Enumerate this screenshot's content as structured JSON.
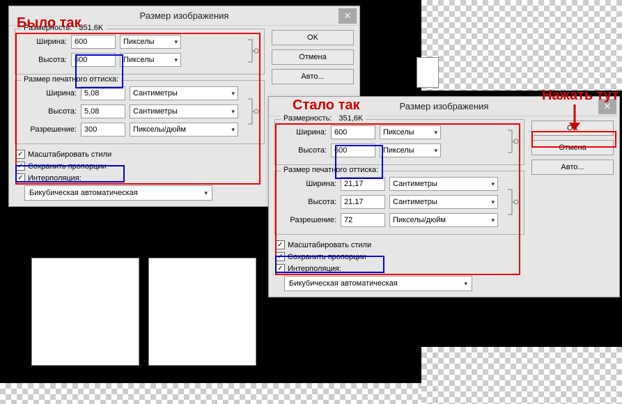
{
  "annotations": {
    "before": "Было так",
    "after": "Стало так",
    "press_here": "Нажать тут"
  },
  "dialog1": {
    "title": "Размер изображения",
    "buttons": {
      "ok": "OK",
      "cancel": "Отмена",
      "auto": "Авто..."
    },
    "dimensions": {
      "label": "Размерность:",
      "value": "351,6K",
      "width_label": "Ширина:",
      "width": "600",
      "height_label": "Высота:",
      "height": "600",
      "unit": "Пикселы"
    },
    "print": {
      "label": "Размер печатного оттиска:",
      "width_label": "Ширина:",
      "width": "5,08",
      "height_label": "Высота:",
      "height": "5,08",
      "unit": "Сантиметры",
      "res_label": "Разрешение:",
      "res": "300",
      "res_unit": "Пикселы/дюйм"
    },
    "opts": {
      "scale": "Масштабировать стили",
      "constrain": "Сохранить пропорции",
      "interp": "Интерполяция:"
    },
    "interp_method": "Бикубическая автоматическая"
  },
  "dialog2": {
    "title": "Размер изображения",
    "buttons": {
      "ok": "OK",
      "cancel": "Отмена",
      "auto": "Авто..."
    },
    "dimensions": {
      "label": "Размерность:",
      "value": "351,6K",
      "width_label": "Ширина:",
      "width": "600",
      "height_label": "Высота:",
      "height": "600",
      "unit": "Пикселы"
    },
    "print": {
      "label": "Размер печатного оттиска:",
      "width_label": "Ширина:",
      "width": "21,17",
      "height_label": "Высота:",
      "height": "21,17",
      "unit": "Сантиметры",
      "res_label": "Разрешение:",
      "res": "72",
      "res_unit": "Пикселы/дюйм"
    },
    "opts": {
      "scale": "Масштабировать стили",
      "constrain": "Сохранить пропорции",
      "interp": "Интерполяция:"
    },
    "interp_method": "Бикубическая автоматическая"
  }
}
